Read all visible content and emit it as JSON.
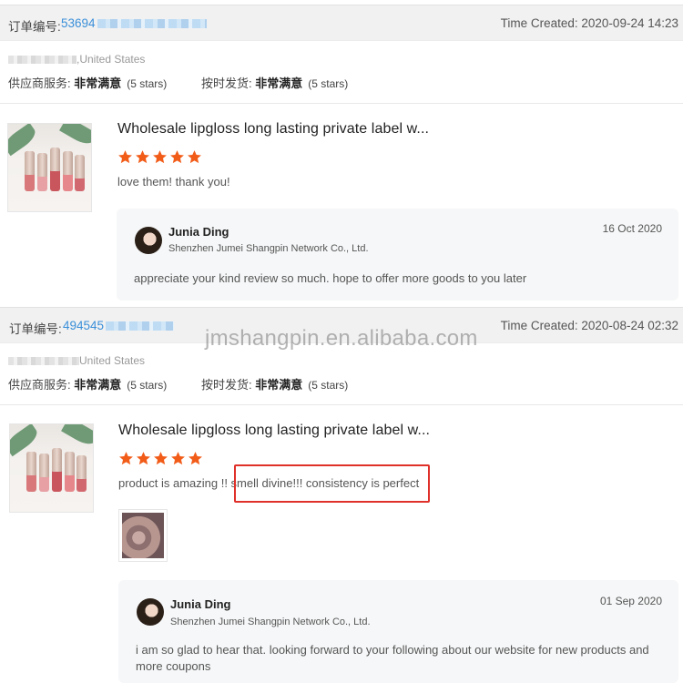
{
  "orders": [
    {
      "order_label": "订单编号:",
      "order_number": "53694",
      "time_created": "Time Created: 2020-09-24 14:23",
      "buyer_location": ",United States",
      "supplier_service_label": "供应商服务:",
      "supplier_service_value": "非常满意",
      "supplier_service_stars": "(5 stars)",
      "shipping_label": "按时发货:",
      "shipping_value": "非常满意",
      "shipping_stars": "(5 stars)",
      "product_title": "Wholesale lipgloss long lasting private label w...",
      "rating": 5,
      "review_text": "love them! thank you!",
      "reply": {
        "name": "Junia Ding",
        "company": "Shenzhen Jumei Shangpin Network Co., Ltd.",
        "date": "16 Oct 2020",
        "message": "appreciate your kind review so much. hope to offer more goods to you later"
      }
    },
    {
      "order_label": "订单编号:",
      "order_number": "494545",
      "time_created": "Time Created: 2020-08-24 02:32",
      "buyer_location": "United States",
      "supplier_service_label": "供应商服务:",
      "supplier_service_value": "非常满意",
      "supplier_service_stars": "(5 stars)",
      "shipping_label": "按时发货:",
      "shipping_value": "非常满意",
      "shipping_stars": "(5 stars)",
      "product_title": "Wholesale lipgloss long lasting private label w...",
      "rating": 5,
      "review_text": "product is amazing !! smell divine!!! consistency is perfect",
      "reply": {
        "name": "Junia Ding",
        "company": "Shenzhen Jumei Shangpin Network Co., Ltd.",
        "date": "01 Sep 2020",
        "message": "i am so glad  to hear that. looking forward to your following about our website for new products and more coupons"
      }
    }
  ],
  "watermark": "jmshangpin.en.alibaba.com",
  "colors": {
    "star": "#f25c19",
    "order_number": "#3a8fd9",
    "highlight": "#e0302a"
  }
}
